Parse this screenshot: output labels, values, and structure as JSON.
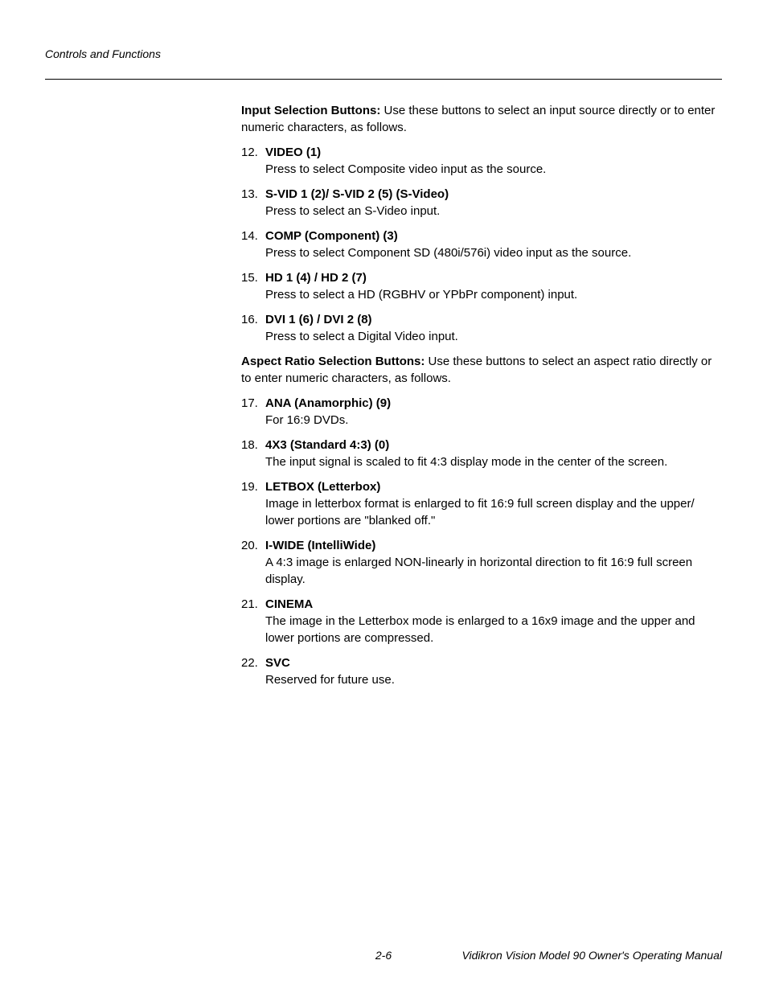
{
  "header": {
    "section": "Controls and Functions"
  },
  "content": {
    "intro1": {
      "bold": "Input Selection Buttons:",
      "text": " Use these buttons to select an input source directly or to enter numeric characters, as follows."
    },
    "list1": [
      {
        "num": "12.",
        "title": "VIDEO (1)",
        "desc": "Press to select Composite video input as the source."
      },
      {
        "num": "13.",
        "title": "S-VID 1 (2)/ S-VID 2 (5) (S-Video)",
        "desc": "Press to select an S-Video input."
      },
      {
        "num": "14.",
        "title": "COMP (Component) (3)",
        "desc": "Press to select Component SD (480i/576i) video input as the source."
      },
      {
        "num": "15.",
        "title": "HD 1 (4) / HD 2 (7)",
        "desc": "Press to select a HD (RGBHV or YPbPr component) input."
      },
      {
        "num": "16.",
        "title": "DVI 1 (6) / DVI 2 (8)",
        "desc": "Press to select a Digital Video input."
      }
    ],
    "intro2": {
      "bold": "Aspect Ratio Selection Buttons:",
      "text": " Use these buttons to select an aspect ratio directly or to enter numeric characters, as follows."
    },
    "list2": [
      {
        "num": "17.",
        "title": "ANA (Anamorphic) (9)",
        "desc": "For 16:9 DVDs."
      },
      {
        "num": "18.",
        "title": "4X3 (Standard 4:3) (0)",
        "desc": "The input signal is scaled to fit 4:3 display mode in the center of the screen."
      },
      {
        "num": "19.",
        "title": "LETBOX (Letterbox)",
        "desc": "Image in letterbox format is enlarged to fit 16:9 full screen display and the upper/ lower portions are \"blanked off.\""
      },
      {
        "num": "20.",
        "title": "I-WIDE (IntelliWide)",
        "desc": "A 4:3 image is enlarged NON-linearly in horizontal direction to fit 16:9 full screen display."
      },
      {
        "num": "21.",
        "title": "CINEMA",
        "desc": "The image in the Letterbox mode is enlarged to a 16x9 image and the upper and lower portions are compressed."
      },
      {
        "num": "22.",
        "title": "SVC",
        "desc": "Reserved for future use."
      }
    ]
  },
  "footer": {
    "page": "2-6",
    "manual": "Vidikron Vision Model 90 Owner's Operating Manual"
  }
}
